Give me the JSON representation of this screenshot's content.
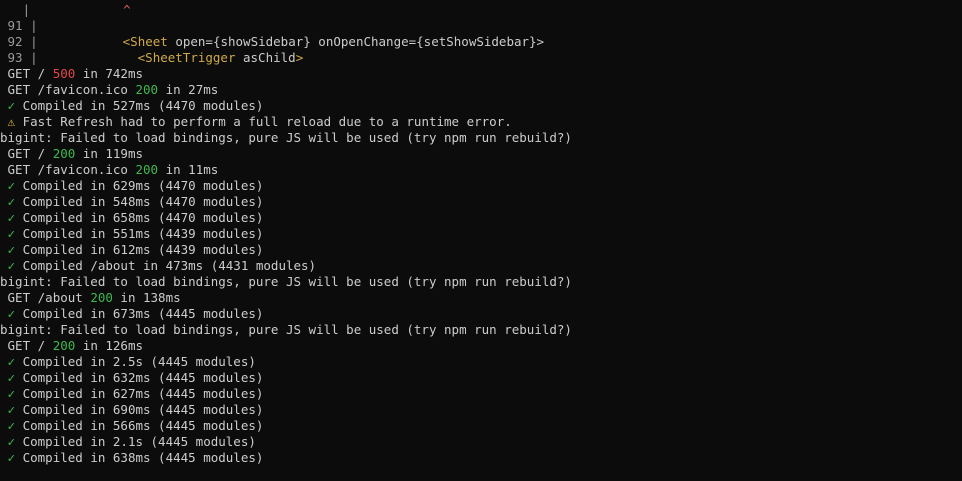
{
  "code_frame": {
    "caret_gutter": "   |",
    "caret": "^",
    "lines": [
      {
        "gutter": " 91 |",
        "tag": "",
        "text": ""
      },
      {
        "gutter": " 92 |",
        "tag": "<Sheet",
        "text": " open={showSidebar} onOpenChange={setShowSidebar}>",
        "tag_close": ""
      },
      {
        "gutter": " 93 |",
        "tag": "<SheetTrigger",
        "text": " asChild",
        "tag_close": ">"
      }
    ]
  },
  "log": [
    {
      "kind": "request",
      "method": "GET",
      "path": "/",
      "status": "500",
      "duration": "in 742ms",
      "status_class": "status-500"
    },
    {
      "kind": "request",
      "method": "GET",
      "path": "/favicon.ico",
      "status": "200",
      "duration": "in 27ms",
      "status_class": "status-200"
    },
    {
      "kind": "compiled",
      "icon": "✓",
      "text": "Compiled in 527ms (4470 modules)"
    },
    {
      "kind": "warning",
      "icon": "⚠",
      "text": "Fast Refresh had to perform a full reload due to a runtime error."
    },
    {
      "kind": "plain",
      "text": "bigint: Failed to load bindings, pure JS will be used (try npm run rebuild?)"
    },
    {
      "kind": "request",
      "method": "GET",
      "path": "/",
      "status": "200",
      "duration": "in 119ms",
      "status_class": "status-200"
    },
    {
      "kind": "request",
      "method": "GET",
      "path": "/favicon.ico",
      "status": "200",
      "duration": "in 11ms",
      "status_class": "status-200"
    },
    {
      "kind": "compiled",
      "icon": "✓",
      "text": "Compiled in 629ms (4470 modules)"
    },
    {
      "kind": "compiled",
      "icon": "✓",
      "text": "Compiled in 548ms (4470 modules)"
    },
    {
      "kind": "compiled",
      "icon": "✓",
      "text": "Compiled in 658ms (4470 modules)"
    },
    {
      "kind": "compiled",
      "icon": "✓",
      "text": "Compiled in 551ms (4439 modules)"
    },
    {
      "kind": "compiled",
      "icon": "✓",
      "text": "Compiled in 612ms (4439 modules)"
    },
    {
      "kind": "compiled",
      "icon": "✓",
      "text": "Compiled /about in 473ms (4431 modules)"
    },
    {
      "kind": "plain",
      "text": "bigint: Failed to load bindings, pure JS will be used (try npm run rebuild?)"
    },
    {
      "kind": "request",
      "method": "GET",
      "path": "/about",
      "status": "200",
      "duration": "in 138ms",
      "status_class": "status-200"
    },
    {
      "kind": "compiled",
      "icon": "✓",
      "text": "Compiled in 673ms (4445 modules)"
    },
    {
      "kind": "plain",
      "text": "bigint: Failed to load bindings, pure JS will be used (try npm run rebuild?)"
    },
    {
      "kind": "request",
      "method": "GET",
      "path": "/",
      "status": "200",
      "duration": "in 126ms",
      "status_class": "status-200"
    },
    {
      "kind": "compiled",
      "icon": "✓",
      "text": "Compiled in 2.5s (4445 modules)"
    },
    {
      "kind": "compiled",
      "icon": "✓",
      "text": "Compiled in 632ms (4445 modules)"
    },
    {
      "kind": "compiled",
      "icon": "✓",
      "text": "Compiled in 627ms (4445 modules)"
    },
    {
      "kind": "compiled",
      "icon": "✓",
      "text": "Compiled in 690ms (4445 modules)"
    },
    {
      "kind": "compiled",
      "icon": "✓",
      "text": "Compiled in 566ms (4445 modules)"
    },
    {
      "kind": "compiled",
      "icon": "✓",
      "text": "Compiled in 2.1s (4445 modules)"
    },
    {
      "kind": "compiled",
      "icon": "✓",
      "text": "Compiled in 638ms (4445 modules)"
    }
  ],
  "colors": {
    "background": "#0c0c0c",
    "text": "#cccccc",
    "status_500": "#e04848",
    "status_200": "#3fb64f",
    "jsx_tag": "#d0a94a",
    "caret": "#e05a5a",
    "warning_icon": "#e8c33a"
  }
}
